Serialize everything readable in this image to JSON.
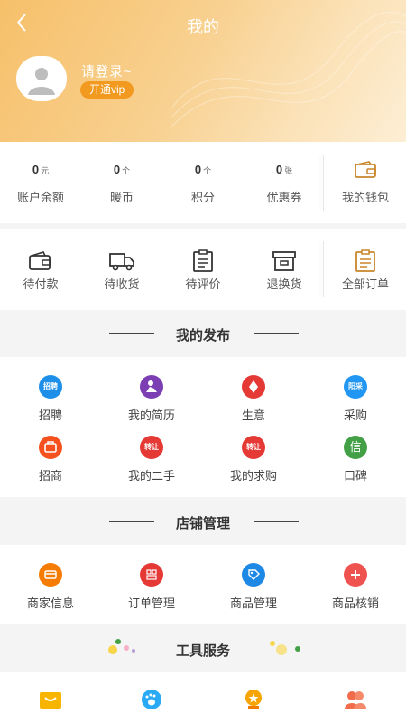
{
  "header": {
    "title": "我的",
    "login_text": "请登录~",
    "vip_label": "开通vip"
  },
  "stats": [
    {
      "value": "0",
      "unit": "元",
      "label": "账户余额"
    },
    {
      "value": "0",
      "unit": "个",
      "label": "暖币"
    },
    {
      "value": "0",
      "unit": "个",
      "label": "积分"
    },
    {
      "value": "0",
      "unit": "张",
      "label": "优惠券"
    }
  ],
  "wallet_label": "我的钱包",
  "orders": [
    {
      "label": "待付款",
      "icon": "wallet-icon"
    },
    {
      "label": "待收货",
      "icon": "truck-icon"
    },
    {
      "label": "待评价",
      "icon": "clipboard-icon"
    },
    {
      "label": "退换货",
      "icon": "box-icon"
    }
  ],
  "all_orders_label": "全部订单",
  "publish": {
    "title": "我的发布",
    "items": [
      {
        "label": "招聘",
        "badge": "招聘",
        "color": "#1e8fe8"
      },
      {
        "label": "我的简历",
        "badge": "",
        "color": "#7b3fb3"
      },
      {
        "label": "生意",
        "badge": "",
        "color": "#e53935"
      },
      {
        "label": "采购",
        "badge": "阳采",
        "color": "#2196f3"
      },
      {
        "label": "招商",
        "badge": "",
        "color": "#f4511e"
      },
      {
        "label": "我的二手",
        "badge": "转让",
        "color": "#e53935"
      },
      {
        "label": "我的求购",
        "badge": "转让",
        "color": "#e53935"
      },
      {
        "label": "口碑",
        "badge": "信",
        "color": "#43a047"
      }
    ]
  },
  "shop": {
    "title": "店铺管理",
    "items": [
      {
        "label": "商家信息",
        "color": "#f57c00"
      },
      {
        "label": "订单管理",
        "color": "#e53935"
      },
      {
        "label": "商品管理",
        "color": "#1e88e5"
      },
      {
        "label": "商品核销",
        "color": "#ef5350"
      }
    ]
  },
  "tools": {
    "title": "工具服务",
    "icons": [
      {
        "name": "cart-icon",
        "color": "#f7b500"
      },
      {
        "name": "footprint-icon",
        "color": "#2aa9f5"
      },
      {
        "name": "medal-icon",
        "color": "#f7a400"
      },
      {
        "name": "people-icon",
        "color": "#f26b4b"
      }
    ]
  }
}
